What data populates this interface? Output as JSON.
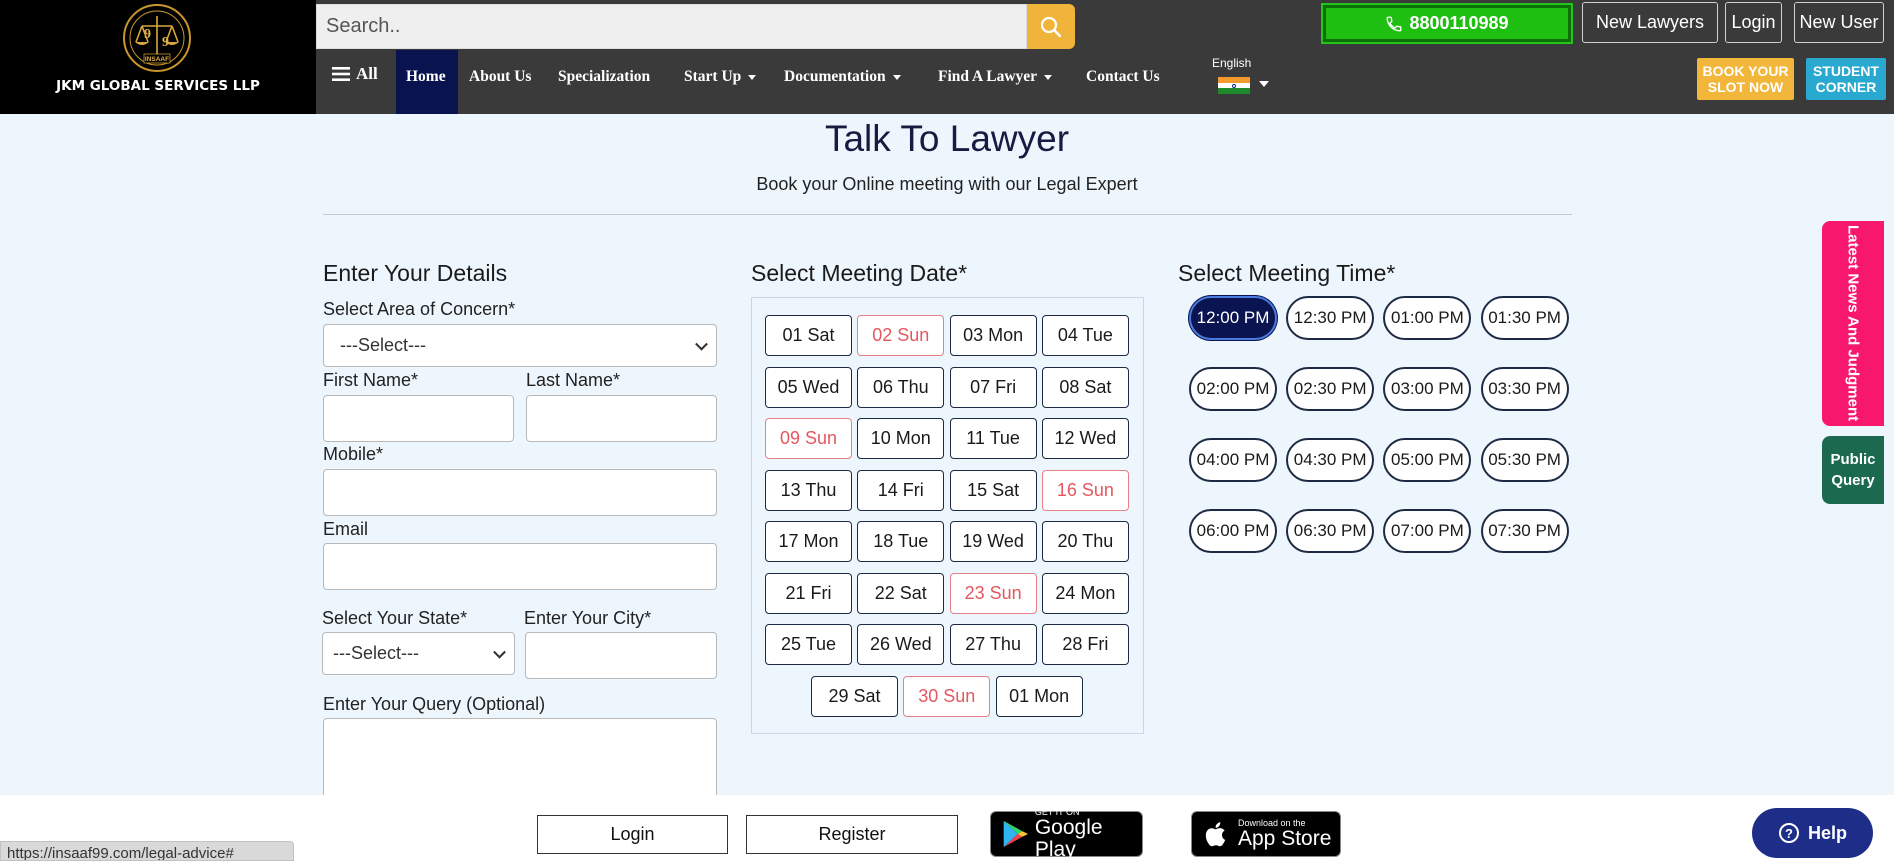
{
  "header": {
    "brand_name": "JKM GLOBAL SERVICES LLP",
    "logo_text": "INSAAF",
    "search_placeholder": "Search..",
    "phone": "8800110989",
    "new_lawyers": "New Lawyers",
    "login": "Login",
    "new_user": "New User",
    "language": "English",
    "book_slot": "BOOK YOUR SLOT NOW",
    "student_corner": "STUDENT CORNER"
  },
  "nav": {
    "all": "All",
    "items": [
      "Home",
      "About Us",
      "Specialization",
      "Start Up",
      "Documentation",
      "Find A Lawyer",
      "Contact Us"
    ]
  },
  "page": {
    "title": "Talk To Lawyer",
    "subtitle": "Book your Online meeting with our Legal Expert"
  },
  "details": {
    "heading": "Enter Your Details",
    "area_label": "Select Area of Concern*",
    "area_value": "---Select---",
    "first_name_label": "First Name*",
    "last_name_label": "Last Name*",
    "mobile_label": "Mobile*",
    "email_label": "Email",
    "state_label": "Select Your State*",
    "state_value": "---Select---",
    "city_label": "Enter Your City*",
    "query_label": "Enter Your Query (Optional)"
  },
  "dates": {
    "heading": "Select Meeting Date*",
    "items": [
      {
        "label": "01 Sat",
        "sunday": false
      },
      {
        "label": "02 Sun",
        "sunday": true
      },
      {
        "label": "03 Mon",
        "sunday": false
      },
      {
        "label": "04 Tue",
        "sunday": false
      },
      {
        "label": "05 Wed",
        "sunday": false
      },
      {
        "label": "06 Thu",
        "sunday": false
      },
      {
        "label": "07 Fri",
        "sunday": false
      },
      {
        "label": "08 Sat",
        "sunday": false
      },
      {
        "label": "09 Sun",
        "sunday": true
      },
      {
        "label": "10 Mon",
        "sunday": false
      },
      {
        "label": "11 Tue",
        "sunday": false
      },
      {
        "label": "12 Wed",
        "sunday": false
      },
      {
        "label": "13 Thu",
        "sunday": false
      },
      {
        "label": "14 Fri",
        "sunday": false
      },
      {
        "label": "15 Sat",
        "sunday": false
      },
      {
        "label": "16 Sun",
        "sunday": true
      },
      {
        "label": "17 Mon",
        "sunday": false
      },
      {
        "label": "18 Tue",
        "sunday": false
      },
      {
        "label": "19 Wed",
        "sunday": false
      },
      {
        "label": "20 Thu",
        "sunday": false
      },
      {
        "label": "21 Fri",
        "sunday": false
      },
      {
        "label": "22 Sat",
        "sunday": false
      },
      {
        "label": "23 Sun",
        "sunday": true
      },
      {
        "label": "24 Mon",
        "sunday": false
      },
      {
        "label": "25 Tue",
        "sunday": false
      },
      {
        "label": "26 Wed",
        "sunday": false
      },
      {
        "label": "27 Thu",
        "sunday": false
      },
      {
        "label": "28 Fri",
        "sunday": false
      },
      {
        "label": "29 Sat",
        "sunday": false
      },
      {
        "label": "30 Sun",
        "sunday": true
      },
      {
        "label": "01 Mon",
        "sunday": false
      }
    ]
  },
  "times": {
    "heading": "Select Meeting Time*",
    "selected": "12:00 PM",
    "items": [
      "12:00 PM",
      "12:30 PM",
      "01:00 PM",
      "01:30 PM",
      "02:00 PM",
      "02:30 PM",
      "03:00 PM",
      "03:30 PM",
      "04:00 PM",
      "04:30 PM",
      "05:00 PM",
      "05:30 PM",
      "06:00 PM",
      "06:30 PM",
      "07:00 PM",
      "07:30 PM"
    ]
  },
  "side": {
    "news": "Latest News And Judgment",
    "query": "Public Query"
  },
  "bottom": {
    "login": "Login",
    "register": "Register",
    "google_small": "GET IT ON",
    "google_big": "Google Play",
    "apple_small": "Download on the",
    "apple_big": "App Store",
    "help": "Help",
    "status_url": "https://insaaf99.com/legal-advice#"
  },
  "colors": {
    "header_bg": "#3a3a3a",
    "active_nav": "#081350",
    "phone_green": "#1fbf12",
    "sunday_red": "#e4575f",
    "news_pink": "#f7186e",
    "query_green": "#1b6a4f"
  }
}
